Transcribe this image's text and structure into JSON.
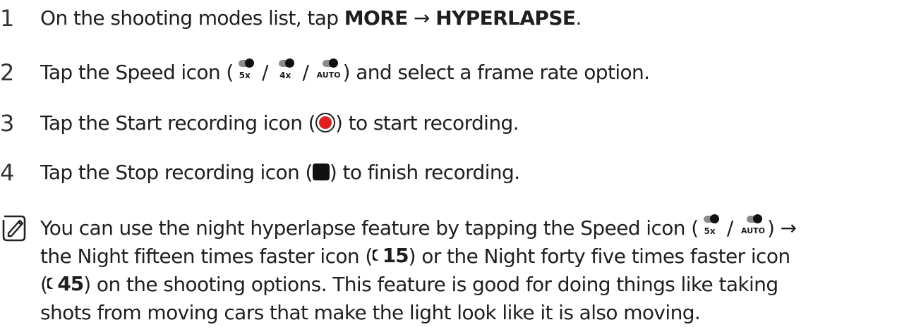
{
  "steps": [
    {
      "number": "1",
      "text_before": "On the shooting modes list, tap ",
      "more_label": "MORE",
      "arrow": " → ",
      "hyperlapse_label": "HYPERLAPSE",
      "text_after": "."
    },
    {
      "number": "2",
      "text_before": "Tap the Speed icon (",
      "icon_labels": [
        "5x",
        "4x",
        "AUTO"
      ],
      "separator": " / ",
      "text_after": ") and select a frame rate option."
    },
    {
      "number": "3",
      "text_before": "Tap the Start recording icon (",
      "text_after": ") to start recording."
    },
    {
      "number": "4",
      "text_before": "Tap the Stop recording icon (",
      "text_after": ") to finish recording."
    }
  ],
  "note": {
    "icon": "note-pencil-icon",
    "line1_before": "You can use the night hyperlapse feature by tapping the Speed icon (",
    "line1_icon_labels": [
      "5x",
      "AUTO"
    ],
    "line1_separator": " / ",
    "line1_after": ") →",
    "line2_before": "the Night fifteen times faster icon (",
    "night15": "15",
    "line2_mid": ") or the Night forty five times faster icon",
    "line3_open": "(",
    "night45": "45",
    "line3_after": ") on the shooting options. This feature is good for doing things like taking",
    "line4": "shots from moving cars that make the light look like it is also moving."
  }
}
